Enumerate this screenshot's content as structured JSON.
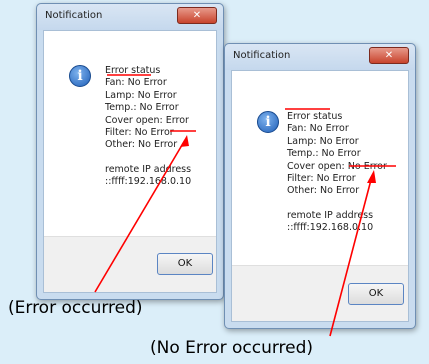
{
  "left_dialog": {
    "title": "Notification",
    "close_icon": "close-x-icon",
    "status_heading": "Error status",
    "lines": [
      "Fan: No Error",
      "Lamp: No Error",
      "Temp.: No Error",
      "Cover open: Error",
      "Filter: No Error",
      "Other: No Error"
    ],
    "ip_label": "remote IP address",
    "ip_value": "::ffff:192.168.0.10",
    "ok_label": "OK"
  },
  "right_dialog": {
    "title": "Notification",
    "close_icon": "close-x-icon",
    "status_heading": "Error status",
    "lines": [
      "Fan: No Error",
      "Lamp: No Error",
      "Temp.: No Error",
      "Cover open: No Error",
      "Filter: No Error",
      "Other: No Error"
    ],
    "ip_label": "remote IP address",
    "ip_value": "::ffff:192.168.0.10",
    "ok_label": "OK"
  },
  "captions": {
    "left": "(Error occurred)",
    "right": "(No Error occurred)"
  },
  "colors": {
    "annotation": "#ff0000",
    "background": "#dbeef9"
  }
}
